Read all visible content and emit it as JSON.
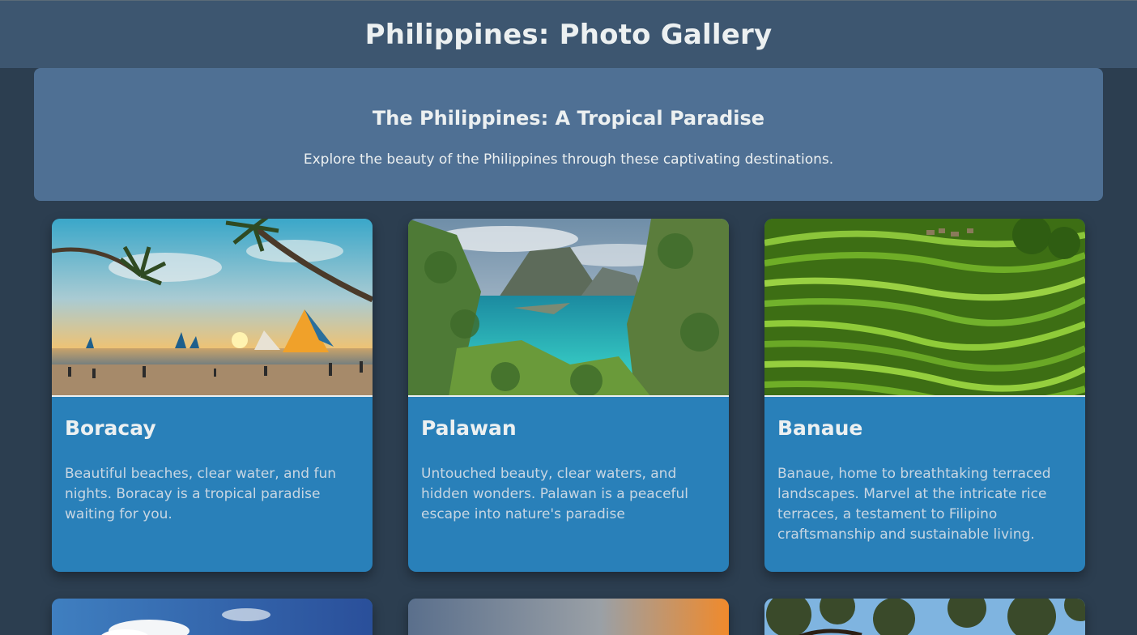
{
  "header": {
    "title": "Philippines: Photo Gallery"
  },
  "intro": {
    "title": "The Philippines: A Tropical Paradise",
    "subtitle": "Explore the beauty of the Philippines through these captivating destinations."
  },
  "cards": [
    {
      "name": "Boracay",
      "description": "Beautiful beaches, clear water, and fun nights. Boracay is a tropical paradise waiting for you."
    },
    {
      "name": "Palawan",
      "description": "Untouched beauty, clear waters, and hidden wonders. Palawan is a peaceful escape into nature's paradise"
    },
    {
      "name": "Banaue",
      "description": "Banaue, home to breathtaking terraced landscapes. Marvel at the intricate rice terraces, a testament to Filipino craftsmanship and sustainable living."
    }
  ],
  "colors": {
    "background": "#2c3e50",
    "header": "#3d5670",
    "intro_panel": "#4f7094",
    "card": "#2980b9",
    "text": "#ecf0f1"
  }
}
